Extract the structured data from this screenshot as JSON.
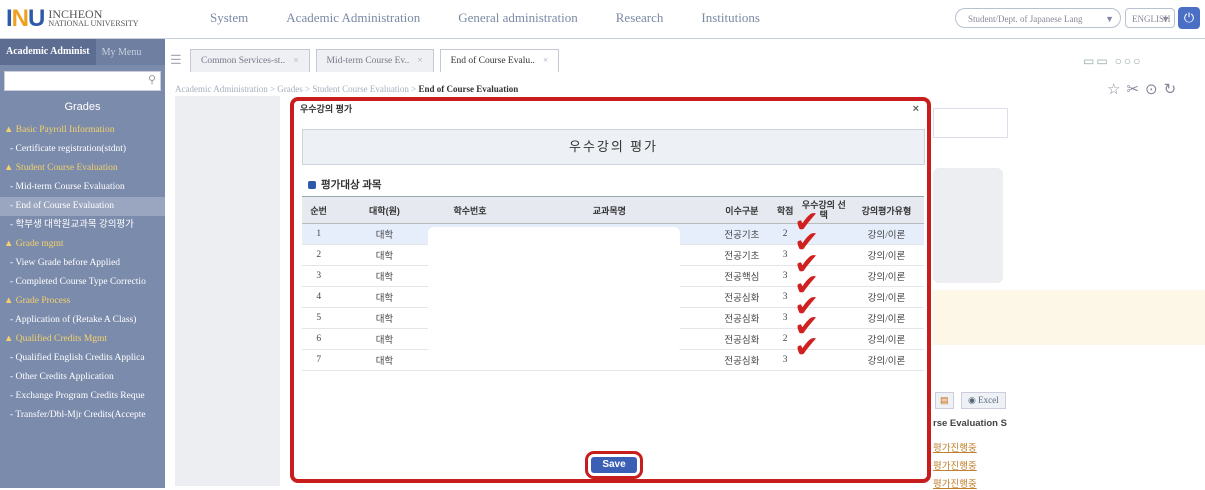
{
  "header": {
    "logo_mark_a": "I",
    "logo_mark_n": "N",
    "logo_mark_b": "U",
    "logo_line1": "INCHEON",
    "logo_line2": "NATIONAL UNIVERSITY",
    "nav": [
      "System",
      "Academic Administration",
      "General administration",
      "Research",
      "Institutions"
    ],
    "dept_select": "Student/Dept. of Japanese Lang",
    "lang_select": "ENGLISH",
    "power_icon": "power-icon"
  },
  "sidebar": {
    "tab_active": "Academic Administ",
    "tab_other": "My Menu",
    "title": "Grades",
    "items": [
      {
        "label": "▲ Basic Payroll Information",
        "type": "group"
      },
      {
        "label": "- Certificate registration(stdnt)",
        "type": "sub"
      },
      {
        "label": "▲ Student Course Evaluation",
        "type": "group"
      },
      {
        "label": "- Mid-term Course Evaluation",
        "type": "sub"
      },
      {
        "label": "- End of Course Evaluation",
        "type": "sub-current"
      },
      {
        "label": "- 학부생 대학원교과목 강의평가",
        "type": "sub"
      },
      {
        "label": "▲ Grade mgmt",
        "type": "group"
      },
      {
        "label": "- View Grade before Applied",
        "type": "sub"
      },
      {
        "label": "- Completed Course Type Correctio",
        "type": "sub"
      },
      {
        "label": "▲ Grade Process",
        "type": "group"
      },
      {
        "label": "- Application of (Retake A Class)",
        "type": "sub"
      },
      {
        "label": "▲ Qualified Credits Mgmt",
        "type": "group"
      },
      {
        "label": "- Qualified English Credits Applica",
        "type": "sub"
      },
      {
        "label": "- Other Credits Application",
        "type": "sub"
      },
      {
        "label": "- Exchange Program Credits Reque",
        "type": "sub"
      },
      {
        "label": "- Transfer/Dbl-Mjr Credits(Accepte",
        "type": "sub"
      }
    ]
  },
  "tabs": [
    "Common Services-st..",
    "Mid-term Course Ev..",
    "End of Course Evalu.."
  ],
  "breadcrumb": {
    "path": "Academic Administration > Grades > Student Course Evaluation > ",
    "current": "End of Course Evaluation"
  },
  "modal": {
    "title": "우수강의 평가",
    "close": "×",
    "banner": "우수강의 평가",
    "section": "평가대상 과목",
    "columns": [
      "순번",
      "대학(원)",
      "학수번호",
      "교과목명",
      "이수구분",
      "학점",
      "우수강의 선택",
      "강의평가유형"
    ],
    "rows": [
      [
        "1",
        "대학",
        "",
        "",
        "전공기초",
        "2",
        "",
        "강의/이론"
      ],
      [
        "2",
        "대학",
        "",
        "",
        "전공기초",
        "3",
        "",
        "강의/이론"
      ],
      [
        "3",
        "대학",
        "",
        "",
        "전공핵심",
        "3",
        "",
        "강의/이론"
      ],
      [
        "4",
        "대학",
        "",
        "",
        "전공심화",
        "3",
        "",
        "강의/이론"
      ],
      [
        "5",
        "대학",
        "",
        "",
        "전공심화",
        "3",
        "",
        "강의/이론"
      ],
      [
        "6",
        "대학",
        "",
        "",
        "전공심화",
        "2",
        "",
        "강의/이론"
      ],
      [
        "7",
        "대학",
        "",
        "",
        "전공심화",
        "3",
        "",
        "강의/이론"
      ]
    ],
    "save_label": "Save"
  },
  "background": {
    "excel_label": "Excel",
    "eval_column": "rse Evaluation S",
    "eval_links": [
      "평가진행중",
      "평가진행중",
      "평가진행중"
    ]
  },
  "colors": {
    "annotation_red": "#c81d1d",
    "sidebar_bg": "#7b8bac",
    "primary_blue": "#3b5fb4"
  }
}
